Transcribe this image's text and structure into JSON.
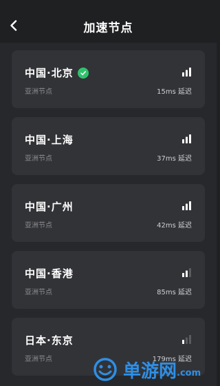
{
  "header": {
    "title": "加速节点"
  },
  "nodes": [
    {
      "name": "中国·北京",
      "region": "亚洲节点",
      "latency": "15ms",
      "latency_suffix": "延迟",
      "selected": true,
      "signal_bars": 3
    },
    {
      "name": "中国·上海",
      "region": "亚洲节点",
      "latency": "37ms",
      "latency_suffix": "延迟",
      "selected": false,
      "signal_bars": 3
    },
    {
      "name": "中国·广州",
      "region": "亚洲节点",
      "latency": "42ms",
      "latency_suffix": "延迟",
      "selected": false,
      "signal_bars": 3
    },
    {
      "name": "中国·香港",
      "region": "亚洲节点",
      "latency": "85ms",
      "latency_suffix": "延迟",
      "selected": false,
      "signal_bars": 2
    },
    {
      "name": "日本·东京",
      "region": "亚洲节点",
      "latency": "179ms",
      "latency_suffix": "延迟",
      "selected": false,
      "signal_bars": 1
    }
  ],
  "watermark": {
    "text": "单游网",
    "domain": ".com"
  },
  "colors": {
    "background": "#1f2022",
    "card": "#323337",
    "selected_check": "#2fc36c",
    "watermark": "#2e8fe6"
  }
}
